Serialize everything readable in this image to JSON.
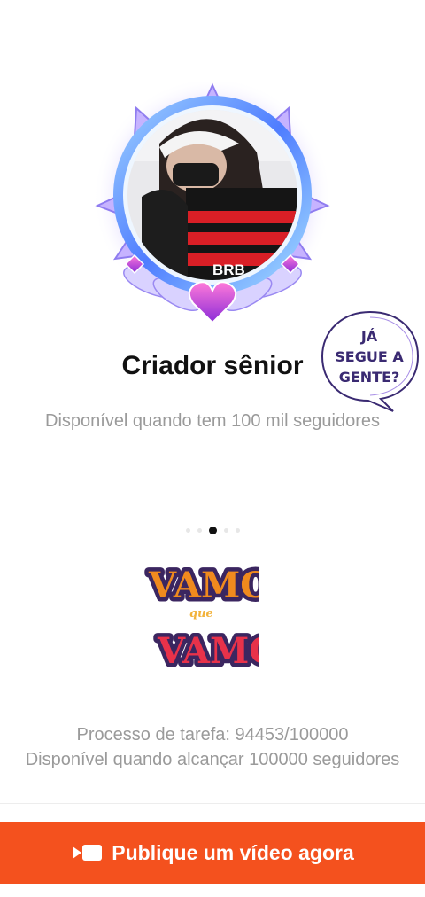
{
  "badge": {
    "title": "Criador sênior",
    "requirement": "Disponível quando tem 100 mil seguidores",
    "jersey_sponsor": "BRB"
  },
  "sticker": {
    "line1": "JÁ",
    "line2": "SEGUE A",
    "line3": "GENTE?"
  },
  "carousel": {
    "page_count": 5,
    "active_index": 2
  },
  "logo": {
    "word1": "VAMO",
    "word2": "que",
    "word3": "VAMO"
  },
  "task": {
    "progress_text": "Processo de tarefa: 94453/100000",
    "progress_value": 94453,
    "progress_goal": 100000,
    "requirement": "Disponível quando alcançar 100000 seguidores"
  },
  "cta": {
    "label": "Publique um vídeo agora",
    "icon": "video-camera-icon"
  },
  "colors": {
    "accent": "#f4511e",
    "muted_text": "#9a9a9a"
  }
}
